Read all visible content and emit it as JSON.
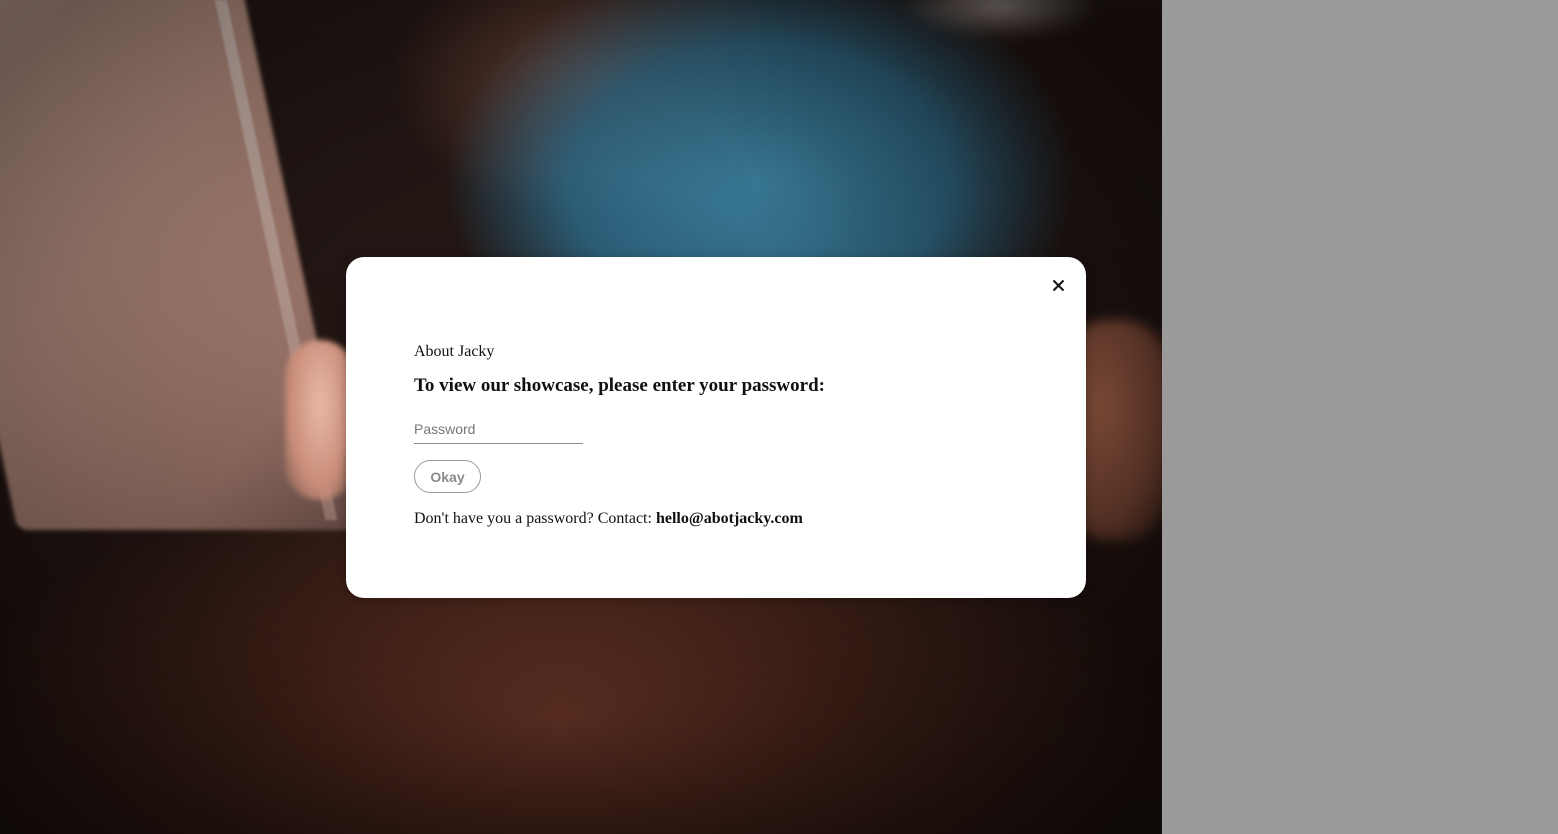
{
  "modal": {
    "site_name": "About Jacky",
    "prompt": "To view our showcase, please enter your password:",
    "password_placeholder": "Password",
    "password_value": "",
    "okay_label": "Okay",
    "contact_text": "Don't have you a password? Contact: ",
    "contact_email": "hello@abotjacky.com",
    "close_icon": "close-icon"
  },
  "colors": {
    "modal_background": "#ffffff",
    "page_background": "#9a9a9a",
    "button_border": "#9a9a9a",
    "button_text": "#8a8a8a"
  }
}
